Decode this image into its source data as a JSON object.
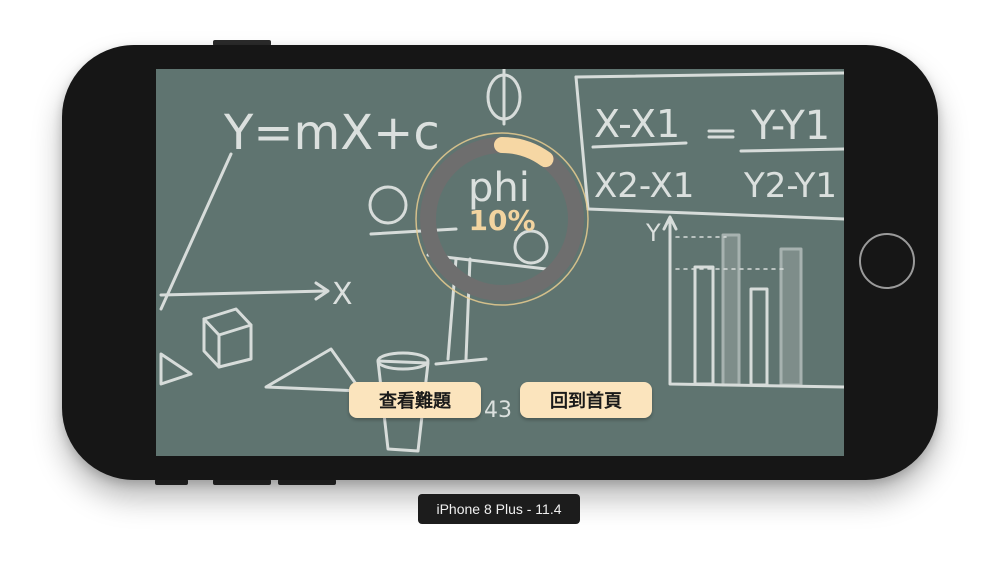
{
  "screen": {
    "background_color": "#5f7470",
    "chalkboard": {
      "equation_line": "Y=mX+c",
      "equation_axis": "X",
      "phi_word": "phi",
      "formula_x": "X-X1",
      "formula_x2": "X2-X1",
      "formula_y": "Y-Y1",
      "formula_y2": "Y2-Y1",
      "axis_y": "Y",
      "number": "43"
    },
    "progress": {
      "label": "10%",
      "value": 0.1,
      "track_color": "#6e6e6e",
      "fill_color": "#f6d7a4"
    },
    "buttons": {
      "review_label": "查看難題",
      "home_label": "回到首頁",
      "background_color": "#fbe4bd"
    }
  },
  "simulator": {
    "device_label": "iPhone 8 Plus - 11.4"
  }
}
